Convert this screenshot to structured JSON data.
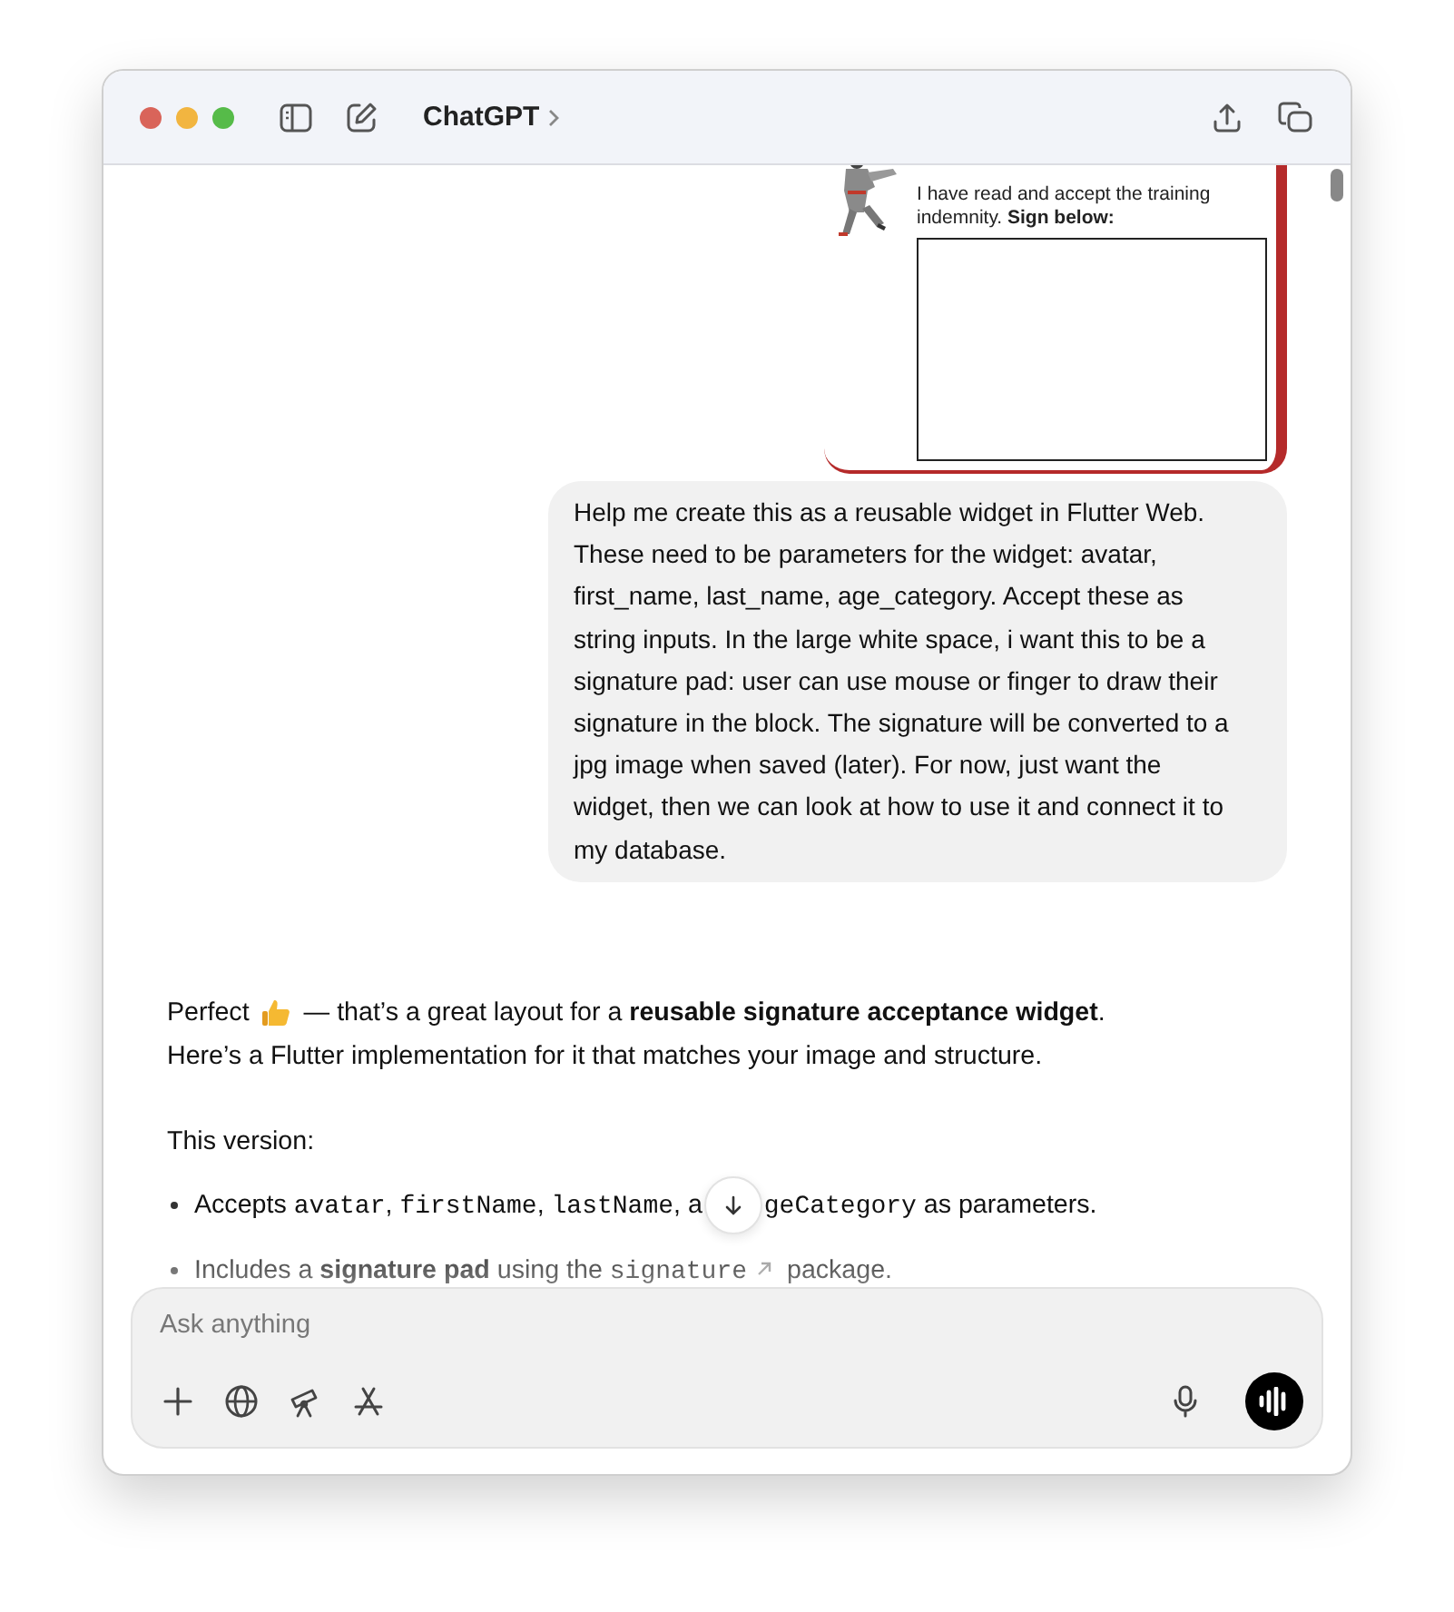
{
  "window": {
    "title": "ChatGPT"
  },
  "image_card": {
    "paragraph": "I have read and accept the training indemnity. **Sign below:**"
  },
  "user_message": "Help me create this as a reusable widget in Flutter Web. These need to be parameters for the widget: avatar, first_name, last_name, age_category. Accept these as string inputs. In the large white space, i want this to be a signature pad: user can use mouse or finger to draw their signature in the block. The signature will be converted to a jpg image when saved (later). For now, just want the widget, then we can look at how to use it and connect it to my database.",
  "reply": {
    "opening_start": "Perfect",
    "opening_rest": "— that’s a great layout for a **reusable signature acceptance widget**.",
    "line_2": "Here’s a Flutter implementation for it that matches your image and structure.",
    "intro": "This version:",
    "bullets": [
      [
        {
          "kind": "text",
          "text": "Accepts "
        },
        {
          "kind": "code",
          "text": "avatar"
        },
        {
          "kind": "text",
          "text": ", "
        },
        {
          "kind": "code",
          "text": "firstName"
        },
        {
          "kind": "text",
          "text": ", "
        },
        {
          "kind": "code",
          "text": "lastName"
        },
        {
          "kind": "text",
          "text": ", a"
        },
        {
          "kind": "scroll_button"
        },
        {
          "kind": "code",
          "text": "geCategory"
        },
        {
          "kind": "text",
          "text": " as parameters."
        }
      ],
      [
        {
          "kind": "text",
          "text": "Includes a "
        },
        {
          "kind": "bold",
          "text": "signature pad"
        },
        {
          "kind": "text",
          "text": " using the "
        },
        {
          "kind": "link",
          "text": "signature"
        },
        {
          "kind": "text",
          "text": " package."
        }
      ]
    ]
  },
  "composer": {
    "placeholder": "Ask anything"
  }
}
